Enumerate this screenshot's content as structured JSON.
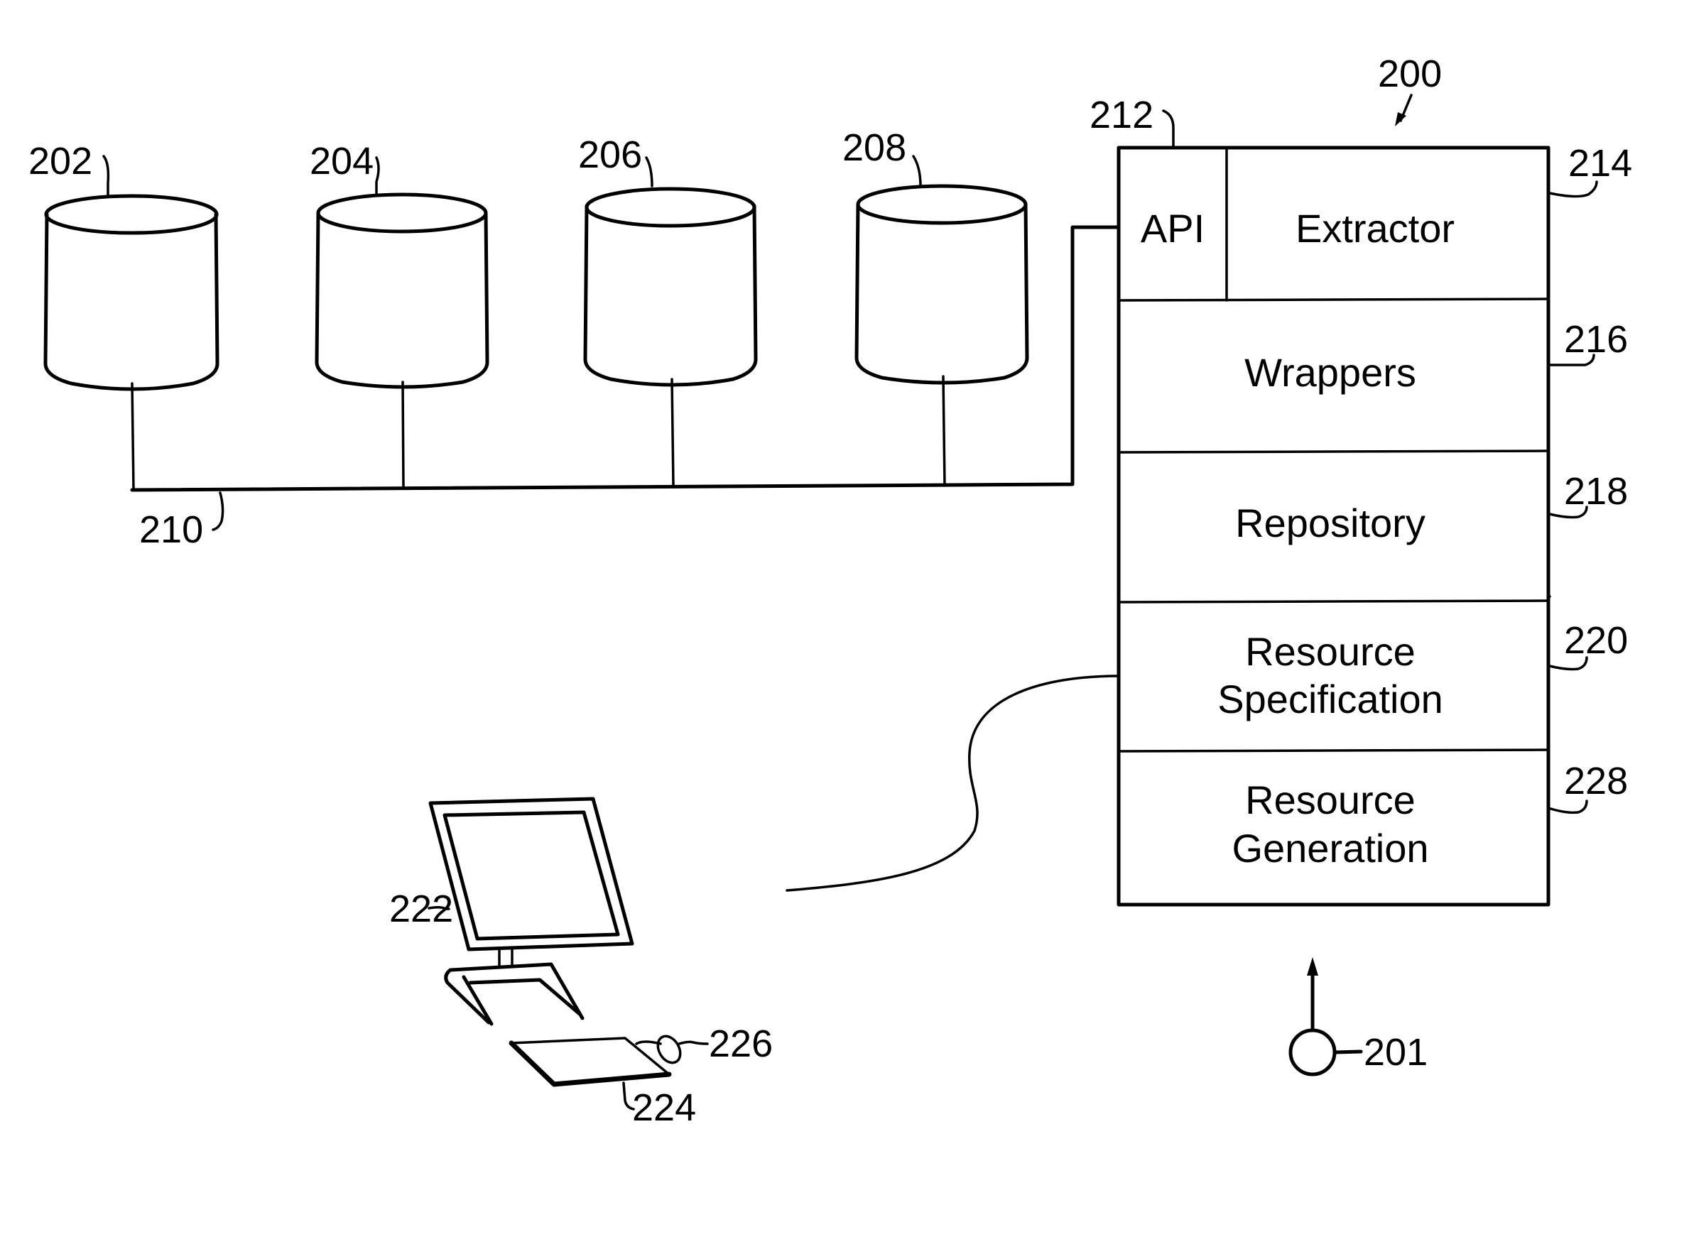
{
  "figure": {
    "system_ref": "200",
    "user_ref": "201",
    "data_sources": [
      {
        "ref": "202"
      },
      {
        "ref": "204"
      },
      {
        "ref": "206"
      },
      {
        "ref": "208"
      }
    ],
    "bus_ref": "210",
    "block": {
      "api": {
        "ref": "212",
        "label": "API"
      },
      "extractor": {
        "ref": "214",
        "label": "Extractor"
      },
      "wrappers": {
        "ref": "216",
        "label": "Wrappers"
      },
      "repository": {
        "ref": "218",
        "label": "Repository"
      },
      "resource_specification": {
        "ref": "220",
        "line1": "Resource",
        "line2": "Specification"
      },
      "resource_generation": {
        "ref": "228",
        "line1": "Resource",
        "line2": "Generation"
      }
    },
    "monitor_ref": "222",
    "keyboard_ref": "224",
    "mouse_ref": "226"
  }
}
